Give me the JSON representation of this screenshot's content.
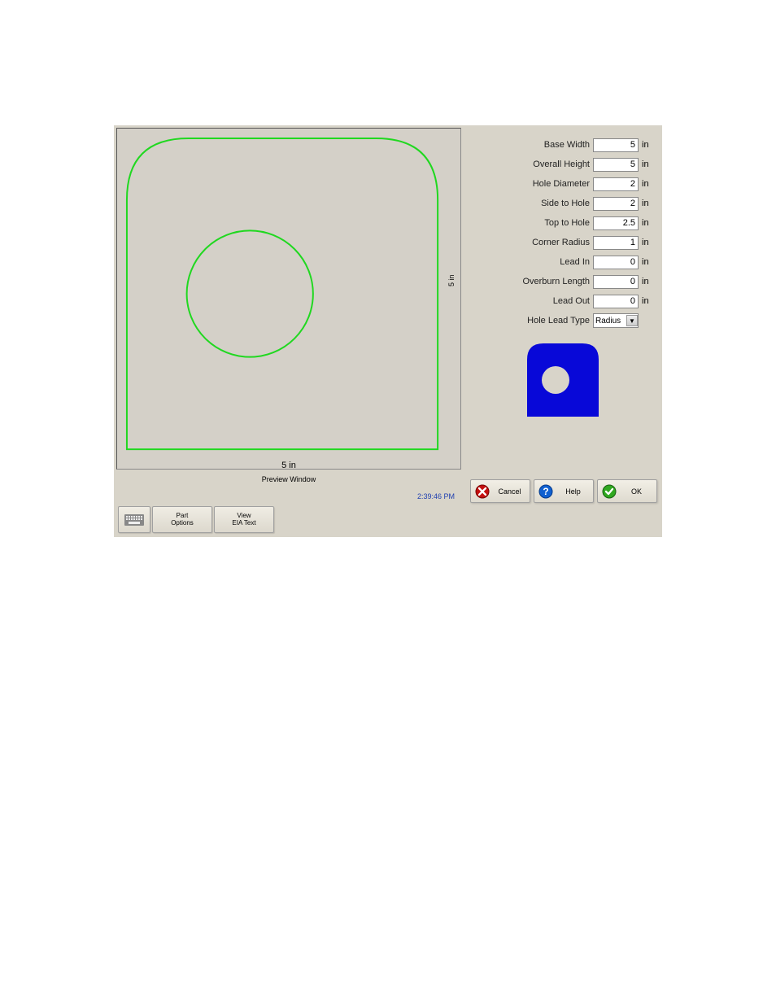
{
  "preview": {
    "width_label": "5 in",
    "height_label": "5 in",
    "caption": "Preview Window"
  },
  "time": "2:39:46 PM",
  "params": {
    "base_width": {
      "label": "Base Width",
      "value": "5",
      "unit": "in"
    },
    "overall_height": {
      "label": "Overall Height",
      "value": "5",
      "unit": "in"
    },
    "hole_diameter": {
      "label": "Hole Diameter",
      "value": "2",
      "unit": "in"
    },
    "side_to_hole": {
      "label": "Side to Hole",
      "value": "2",
      "unit": "in"
    },
    "top_to_hole": {
      "label": "Top to Hole",
      "value": "2.5",
      "unit": "in"
    },
    "corner_radius": {
      "label": "Corner Radius",
      "value": "1",
      "unit": "in"
    },
    "lead_in": {
      "label": "Lead In",
      "value": "0",
      "unit": "in"
    },
    "overburn_length": {
      "label": "Overburn Length",
      "value": "0",
      "unit": "in"
    },
    "lead_out": {
      "label": "Lead Out",
      "value": "0",
      "unit": "in"
    },
    "hole_lead_type": {
      "label": "Hole Lead Type",
      "value": "Radius"
    }
  },
  "buttons": {
    "keyboard": "",
    "part_options": "Part\nOptions",
    "view_eia_text": "View\nEIA Text",
    "cancel": "Cancel",
    "help": "Help",
    "ok": "OK"
  }
}
